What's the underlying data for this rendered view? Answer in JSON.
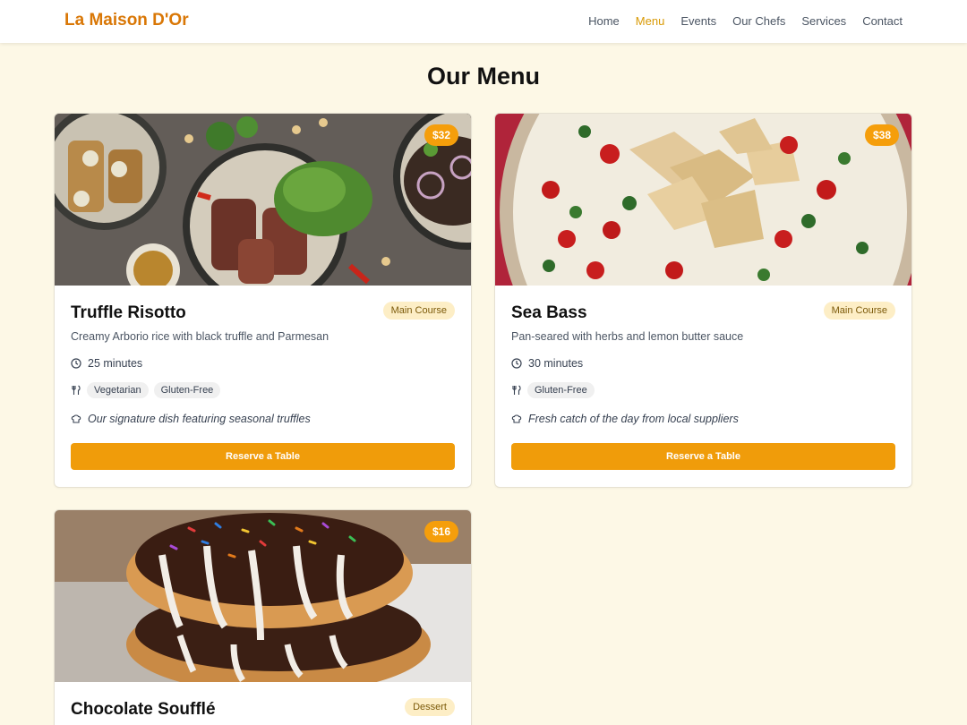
{
  "header": {
    "brand": "La Maison D'Or",
    "nav": [
      {
        "label": "Home",
        "active": false
      },
      {
        "label": "Menu",
        "active": true
      },
      {
        "label": "Events",
        "active": false
      },
      {
        "label": "Our Chefs",
        "active": false
      },
      {
        "label": "Services",
        "active": false
      },
      {
        "label": "Contact",
        "active": false
      }
    ]
  },
  "page": {
    "title": "Our Menu"
  },
  "menu": [
    {
      "name": "Truffle Risotto",
      "price": "$32",
      "category": "Main Course",
      "description": "Creamy Arborio rice with black truffle and Parmesan",
      "time": "25 minutes",
      "tags": [
        "Vegetarian",
        "Gluten-Free"
      ],
      "note": "Our signature dish featuring seasonal truffles",
      "button": "Reserve a Table",
      "image_icon": "plated-dishes-photo"
    },
    {
      "name": "Sea Bass",
      "price": "$38",
      "category": "Main Course",
      "description": "Pan-seared with herbs and lemon butter sauce",
      "time": "30 minutes",
      "tags": [
        "Gluten-Free"
      ],
      "note": "Fresh catch of the day from local suppliers",
      "button": "Reserve a Table",
      "image_icon": "dip-platter-photo"
    },
    {
      "name": "Chocolate Soufflé",
      "price": "$16",
      "category": "Dessert",
      "image_icon": "donuts-photo"
    }
  ],
  "colors": {
    "accent": "#f09c0a",
    "brand": "#d97706",
    "background": "#fdf8e6"
  }
}
